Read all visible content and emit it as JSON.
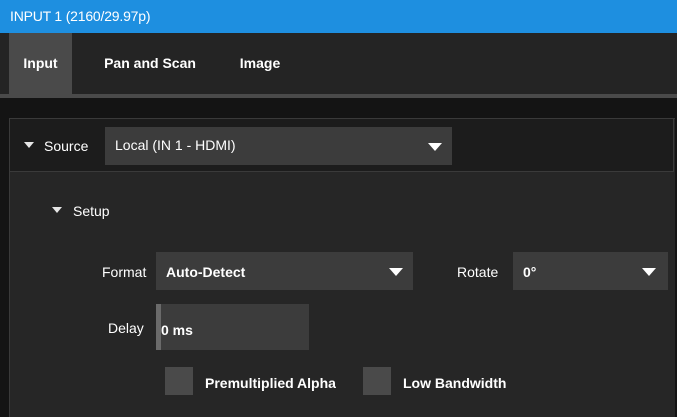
{
  "window": {
    "title": "INPUT 1  (2160/29.97p)"
  },
  "tabs": [
    {
      "label": "Input",
      "active": true
    },
    {
      "label": "Pan and Scan",
      "active": false
    },
    {
      "label": "Image",
      "active": false
    }
  ],
  "source": {
    "label": "Source",
    "selected": "Local (IN 1 - HDMI)"
  },
  "setup": {
    "label": "Setup",
    "format": {
      "label": "Format",
      "selected": "Auto-Detect"
    },
    "rotate": {
      "label": "Rotate",
      "selected": "0°"
    },
    "delay": {
      "label": "Delay",
      "value": "0 ms"
    },
    "premultiplied_alpha": {
      "label": "Premultiplied Alpha",
      "checked": false
    },
    "low_bandwidth": {
      "label": "Low Bandwidth",
      "checked": false
    }
  },
  "icons": {
    "collapse": "triangle-down-icon",
    "dropdown": "caret-down-icon"
  },
  "colors": {
    "titlebar": "#1e8fe0",
    "background": "#141414",
    "panel": "#262626",
    "field": "#3c3c3c",
    "active_tab": "#4a4a4a"
  }
}
